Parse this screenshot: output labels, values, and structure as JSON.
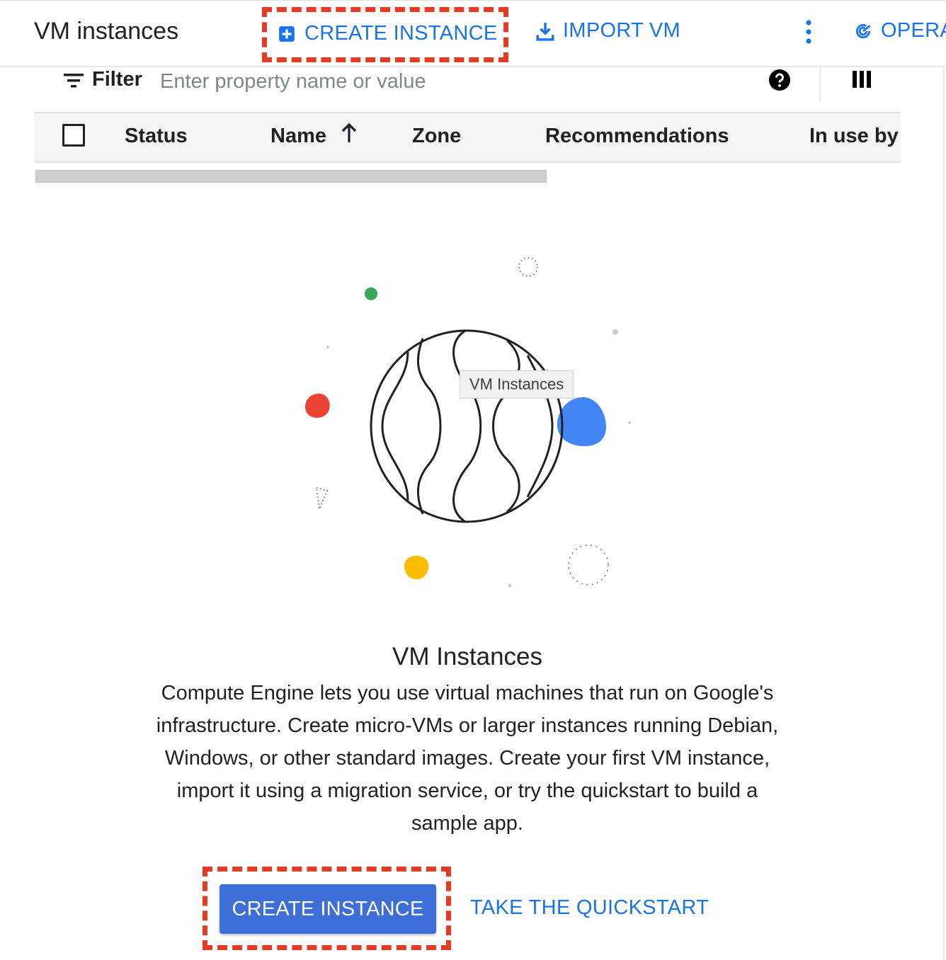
{
  "header": {
    "title": "VM instances",
    "create_instance_label": "CREATE INSTANCE",
    "import_vm_label": "IMPORT VM",
    "operations_label": "OPERA",
    "more_icon": "more-vert-icon",
    "accent_color": "#1a73e8"
  },
  "filter": {
    "label": "Filter",
    "placeholder": "Enter property name or value",
    "help_icon": "help-icon",
    "columns_icon": "column-display-icon"
  },
  "table": {
    "columns": [
      "Status",
      "Name",
      "Zone",
      "Recommendations",
      "In use by"
    ],
    "sorted_column": "Name",
    "sort_direction": "ascending",
    "rows": []
  },
  "empty_state": {
    "tooltip": "VM Instances",
    "title": "VM Instances",
    "description": "Compute Engine lets you use virtual machines that run on Google's infrastructure. Create micro-VMs or larger instances running Debian, Windows, or other standard images. Create your first VM instance, import it using a migration service, or try the quickstart to build a sample app.",
    "primary_button": "CREATE INSTANCE",
    "secondary_button": "TAKE THE QUICKSTART"
  },
  "highlight_color": "#e53a23"
}
